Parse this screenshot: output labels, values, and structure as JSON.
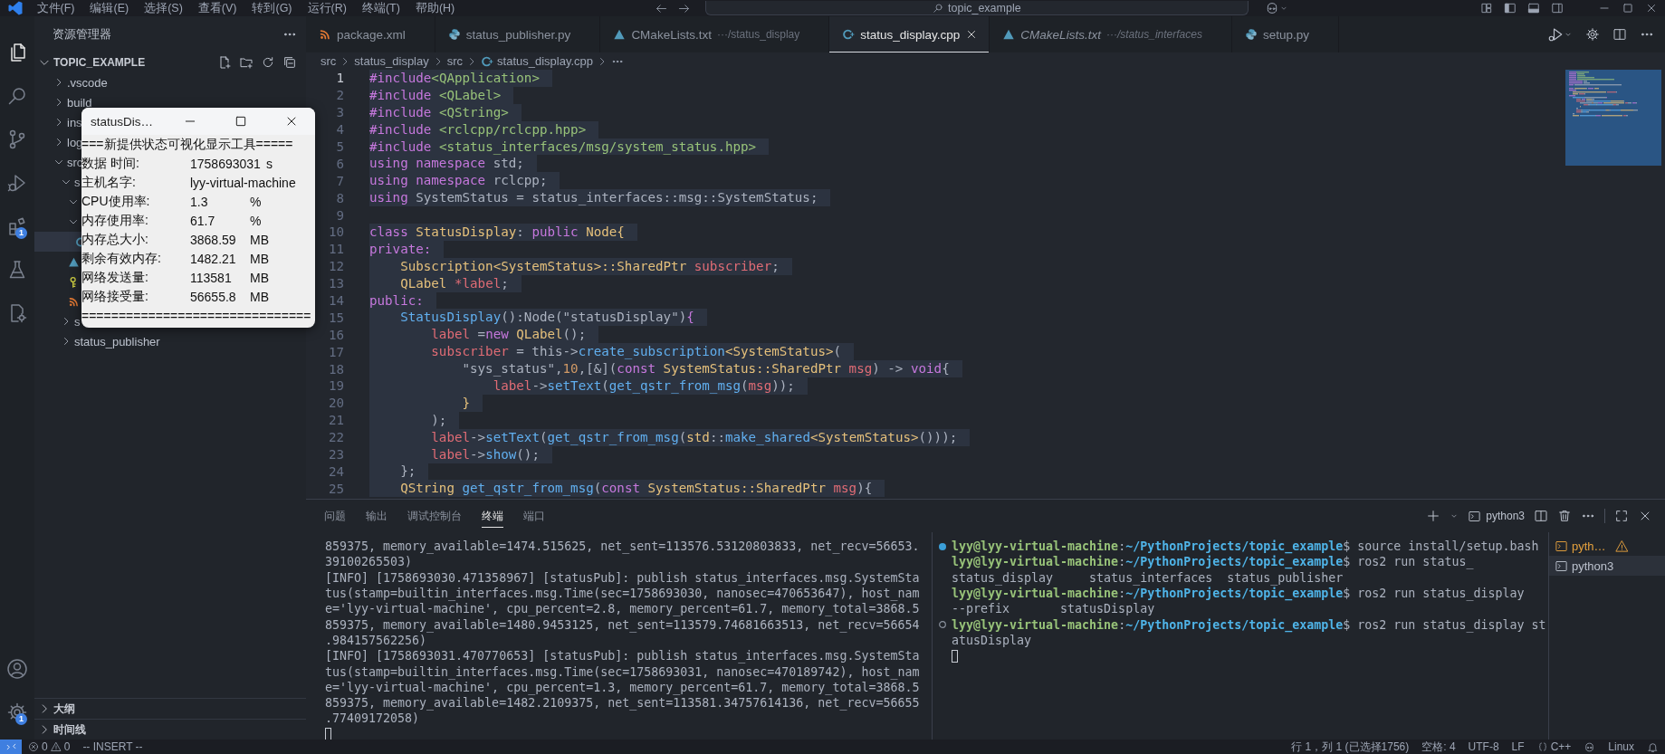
{
  "title_bar": {
    "menus": [
      "文件(F)",
      "编辑(E)",
      "选择(S)",
      "查看(V)",
      "转到(G)",
      "运行(R)",
      "终端(T)",
      "帮助(H)"
    ],
    "search": {
      "value": "topic_example"
    }
  },
  "activity_bar": {
    "items": [
      {
        "kind": "files",
        "selected": true
      },
      {
        "kind": "search",
        "selected": false
      },
      {
        "kind": "source-control",
        "selected": false
      },
      {
        "kind": "run-debug",
        "selected": false
      },
      {
        "kind": "extensions",
        "selected": false,
        "badge": "1"
      },
      {
        "kind": "testing",
        "selected": false
      },
      {
        "kind": "remote",
        "selected": false
      }
    ],
    "bottom": [
      {
        "kind": "account",
        "selected": false
      },
      {
        "kind": "settings",
        "selected": false,
        "badge": "1"
      }
    ]
  },
  "sidebar": {
    "title": "资源管理器",
    "sections": [
      {
        "title": "TOPIC_EXAMPLE",
        "expanded": true,
        "tree": [
          {
            "label": ".vscode",
            "kind": "folder",
            "expanded": false,
            "selected": false
          },
          {
            "label": "build",
            "kind": "folder",
            "expanded": false,
            "selected": false
          },
          {
            "label": "ins",
            "kind": "folder",
            "expanded": false,
            "selected": false
          },
          {
            "label": "log",
            "kind": "folder",
            "expanded": false,
            "selected": false
          },
          {
            "label": "src",
            "kind": "folder",
            "expanded": true,
            "selected": false,
            "children": [
              {
                "label": "s",
                "kind": "folder",
                "expanded": true,
                "selected": false,
                "children": [
                  {
                    "kind": "folder",
                    "expanded": true,
                    "selected": false
                  },
                  {
                    "kind": "folder",
                    "expanded": true,
                    "selected": false,
                    "children": [
                      {
                        "kind": "cpp",
                        "selected": true
                      }
                    ]
                  },
                  {
                    "kind": "cmake",
                    "selected": false
                  },
                  {
                    "kind": "key",
                    "selected": false
                  },
                  {
                    "kind": "rss",
                    "selected": false
                  }
                ]
              },
              {
                "label": "s",
                "kind": "folder",
                "expanded": false,
                "selected": false
              },
              {
                "label": "status_publisher",
                "kind": "folder",
                "expanded": false,
                "selected": false
              }
            ]
          }
        ]
      },
      {
        "title": "大纲",
        "expanded": false
      },
      {
        "title": "时间线",
        "expanded": false
      }
    ]
  },
  "editor": {
    "tabs": [
      {
        "label": "package.xml",
        "kind": "rss",
        "selected": false,
        "preview": false
      },
      {
        "label": "status_publisher.py",
        "kind": "python",
        "selected": false,
        "preview": false
      },
      {
        "label": "CMakeLists.txt",
        "description": "···/status_display",
        "kind": "cmake",
        "selected": false,
        "preview": false
      },
      {
        "label": "status_display.cpp",
        "kind": "cpp",
        "selected": true,
        "preview": false
      },
      {
        "label": "CMakeLists.txt",
        "description": "···/status_interfaces",
        "kind": "cmake",
        "selected": false,
        "preview": true
      },
      {
        "label": "setup.py",
        "kind": "python",
        "selected": false,
        "preview": false
      }
    ],
    "breadcrumb": [
      {
        "label": "src",
        "kind": "folder"
      },
      {
        "label": "status_display",
        "kind": "folder"
      },
      {
        "label": "src",
        "kind": "folder"
      },
      {
        "label": "status_display.cpp",
        "kind": "cpp"
      }
    ],
    "lines": [
      {
        "number": "1",
        "current": true,
        "tokens": [
          {
            "kind": "kw",
            "text": "#include"
          },
          {
            "kind": "str",
            "text": "<QApplication>"
          }
        ]
      },
      {
        "number": "2",
        "current": false,
        "tokens": [
          {
            "kind": "kw",
            "text": "#include"
          },
          {
            "kind": "str",
            "text": " <QLabel>"
          }
        ]
      },
      {
        "number": "3",
        "current": false,
        "tokens": [
          {
            "kind": "kw",
            "text": "#include"
          },
          {
            "kind": "str",
            "text": " <QString>"
          }
        ]
      },
      {
        "number": "4",
        "current": false,
        "tokens": [
          {
            "kind": "kw",
            "text": "#include"
          },
          {
            "kind": "str",
            "text": " <rclcpp/rclcpp.hpp>"
          }
        ]
      },
      {
        "number": "5",
        "current": false,
        "tokens": [
          {
            "kind": "kw",
            "text": "#include"
          },
          {
            "kind": "str",
            "text": " <status_interfaces/msg/system_status.hpp>"
          }
        ]
      },
      {
        "number": "6",
        "current": false,
        "tokens": [
          {
            "kind": "kw",
            "text": "using namespace"
          },
          {
            "kind": "plain",
            "text": " std;"
          }
        ]
      },
      {
        "number": "7",
        "current": false,
        "tokens": [
          {
            "kind": "kw",
            "text": "using namespace"
          },
          {
            "kind": "plain",
            "text": " rclcpp;"
          }
        ]
      },
      {
        "number": "8",
        "current": false,
        "tokens": [
          {
            "kind": "kw",
            "text": "using"
          },
          {
            "kind": "plain",
            "text": " SystemStatus = status_interfaces::msg::SystemStatus;"
          }
        ]
      },
      {
        "number": "9",
        "current": false
      },
      {
        "number": "10",
        "current": false,
        "tokens": [
          {
            "kind": "kw",
            "text": "class"
          },
          {
            "kind": "type",
            "text": " StatusDisplay"
          },
          {
            "kind": "plain",
            "text": ":"
          },
          {
            "kind": "kw",
            "text": " public"
          },
          {
            "kind": "type",
            "text": " Node{"
          }
        ]
      },
      {
        "number": "11",
        "current": false,
        "tokens": [
          {
            "kind": "kw",
            "text": "private:"
          }
        ]
      },
      {
        "number": "12",
        "current": false,
        "tokens": [
          {
            "kind": "type",
            "text": "    Subscription<SystemStatus>::SharedPtr"
          },
          {
            "kind": "var",
            "text": " subscriber"
          },
          {
            "kind": "plain",
            "text": ";"
          }
        ]
      },
      {
        "number": "13",
        "current": false,
        "tokens": [
          {
            "kind": "type",
            "text": "    QLabel"
          },
          {
            "kind": "var",
            "text": " *label"
          },
          {
            "kind": "plain",
            "text": ";"
          }
        ]
      },
      {
        "number": "14",
        "current": false,
        "tokens": [
          {
            "kind": "kw",
            "text": "public:"
          }
        ]
      },
      {
        "number": "15",
        "current": false,
        "tokens": [
          {
            "kind": "fn",
            "text": "    StatusDisplay"
          },
          {
            "kind": "plain",
            "text": "():Node(\"statusDisplay\")"
          },
          {
            "kind": "kw",
            "text": "{"
          }
        ]
      },
      {
        "number": "16",
        "current": false,
        "tokens": [
          {
            "kind": "var",
            "text": "        label"
          },
          {
            "kind": "plain",
            "text": " ="
          },
          {
            "kind": "kw",
            "text": "new"
          },
          {
            "kind": "type",
            "text": " QLabel"
          },
          {
            "kind": "plain",
            "text": "();"
          }
        ]
      },
      {
        "number": "17",
        "current": false,
        "tokens": [
          {
            "kind": "var",
            "text": "        subscriber"
          },
          {
            "kind": "plain",
            "text": " = this->"
          },
          {
            "kind": "fn",
            "text": "create_subscription"
          },
          {
            "kind": "type",
            "text": "<SystemStatus>"
          },
          {
            "kind": "plain",
            "text": "("
          }
        ]
      },
      {
        "number": "18",
        "current": false,
        "tokens": [
          {
            "kind": "plain",
            "text": "            \"sys_status\","
          },
          {
            "kind": "num",
            "text": "10"
          },
          {
            "kind": "plain",
            "text": ",[&]("
          },
          {
            "kind": "kw",
            "text": "const"
          },
          {
            "kind": "type",
            "text": " SystemStatus::SharedPtr"
          },
          {
            "kind": "var",
            "text": " msg"
          },
          {
            "kind": "plain",
            "text": ") -> "
          },
          {
            "kind": "kw",
            "text": "void"
          },
          {
            "kind": "plain",
            "text": "{"
          }
        ]
      },
      {
        "number": "19",
        "current": false,
        "tokens": [
          {
            "kind": "var",
            "text": "                label"
          },
          {
            "kind": "plain",
            "text": "->"
          },
          {
            "kind": "fn",
            "text": "setText"
          },
          {
            "kind": "plain",
            "text": "("
          },
          {
            "kind": "fn",
            "text": "get_qstr_from_msg"
          },
          {
            "kind": "plain",
            "text": "("
          },
          {
            "kind": "var",
            "text": "msg"
          },
          {
            "kind": "plain",
            "text": "));"
          }
        ]
      },
      {
        "number": "20",
        "current": false,
        "tokens": [
          {
            "kind": "type",
            "text": "            }"
          }
        ]
      },
      {
        "number": "21",
        "current": false,
        "tokens": [
          {
            "kind": "plain",
            "text": "        );"
          }
        ]
      },
      {
        "number": "22",
        "current": false,
        "tokens": [
          {
            "kind": "var",
            "text": "        label"
          },
          {
            "kind": "plain",
            "text": "->"
          },
          {
            "kind": "fn",
            "text": "setText"
          },
          {
            "kind": "plain",
            "text": "("
          },
          {
            "kind": "fn",
            "text": "get_qstr_from_msg"
          },
          {
            "kind": "plain",
            "text": "("
          },
          {
            "kind": "type",
            "text": "std"
          },
          {
            "kind": "plain",
            "text": "::"
          },
          {
            "kind": "fn",
            "text": "make_shared"
          },
          {
            "kind": "type",
            "text": "<SystemStatus>"
          },
          {
            "kind": "plain",
            "text": "()));"
          }
        ]
      },
      {
        "number": "23",
        "current": false,
        "tokens": [
          {
            "kind": "var",
            "text": "        label"
          },
          {
            "kind": "plain",
            "text": "->"
          },
          {
            "kind": "fn",
            "text": "show"
          },
          {
            "kind": "plain",
            "text": "();"
          }
        ]
      },
      {
        "number": "24",
        "current": false,
        "tokens": [
          {
            "kind": "plain",
            "text": "    };"
          }
        ]
      },
      {
        "number": "25",
        "current": false,
        "tokens": [
          {
            "kind": "type",
            "text": "    QString"
          },
          {
            "kind": "fn",
            "text": " get_qstr_from_msg"
          },
          {
            "kind": "plain",
            "text": "("
          },
          {
            "kind": "kw",
            "text": "const"
          },
          {
            "kind": "type",
            "text": " SystemStatus::SharedPtr"
          },
          {
            "kind": "var",
            "text": " msg"
          },
          {
            "kind": "plain",
            "text": "){"
          }
        ]
      }
    ]
  },
  "status_window": {
    "title": "statusDis…",
    "header": "===新提供状态可视化显示工具=====",
    "rows": [
      {
        "label": "数据 时间:",
        "value": "1758693031",
        "unit": "s"
      },
      {
        "label": "主机名字:",
        "value": "lyy-virtual-machine"
      },
      {
        "label": "CPU使用率:",
        "value": "1.3",
        "unit": "%"
      },
      {
        "label": "内存使用率:",
        "value": "61.7",
        "unit": "%"
      },
      {
        "label": "内存总大小:",
        "value": "3868.59",
        "unit": "MB"
      },
      {
        "label": "剩余有效内存:",
        "value": "1482.21",
        "unit": "MB"
      },
      {
        "label": "网络发送量:",
        "value": "113581",
        "unit": "MB"
      },
      {
        "label": "网络接受量:",
        "value": "56655.8",
        "unit": "MB"
      }
    ],
    "footer": "==============================="
  },
  "panel": {
    "tabs": [
      {
        "label": "问题",
        "selected": false
      },
      {
        "label": "输出",
        "selected": false
      },
      {
        "label": "调试控制台",
        "selected": false
      },
      {
        "label": "终端",
        "selected": true
      },
      {
        "label": "端口",
        "selected": false
      }
    ],
    "launch_profile": "python3",
    "output": {
      "cursor": true,
      "lines": [
        "859375, memory_available=1474.515625, net_sent=113576.53120803833, net_recv=56653.",
        "39100265503)",
        "[INFO] [1758693030.471358967] [statusPub]: publish status_interfaces.msg.SystemSta",
        "tus(stamp=builtin_interfaces.msg.Time(sec=1758693030, nanosec=470653647), host_nam",
        "e='lyy-virtual-machine', cpu_percent=2.8, memory_percent=61.7, memory_total=3868.5",
        "859375, memory_available=1480.9453125, net_sent=113579.74681663513, net_recv=56654",
        ".984157562256)",
        "[INFO] [1758693031.470770653] [statusPub]: publish status_interfaces.msg.SystemSta",
        "tus(stamp=builtin_interfaces.msg.Time(sec=1758693031, nanosec=470189742), host_nam",
        "e='lyy-virtual-machine', cpu_percent=1.3, memory_percent=61.7, memory_total=3868.5",
        "859375, memory_available=1482.2109375, net_sent=113581.34757614136, net_recv=56655",
        ".77409172058)"
      ]
    },
    "terminal": {
      "lines": [
        {
          "kind": "prompt",
          "succeeded": true,
          "user": "lyy@lyy-virtual-machine",
          "separator": ":",
          "path": "~/PythonProjects/topic_example",
          "command": "$ source install/setup.bash"
        },
        {
          "kind": "prompt",
          "user": "lyy@lyy-virtual-machine",
          "separator": ":",
          "path": "~/PythonProjects/topic_example",
          "command": "$ ros2 run status_"
        },
        {
          "kind": "output",
          "text": "status_display     status_interfaces  status_publisher"
        },
        {
          "kind": "prompt",
          "user": "lyy@lyy-virtual-machine",
          "separator": ":",
          "path": "~/PythonProjects/topic_example",
          "command": "$ ros2 run status_display"
        },
        {
          "kind": "output",
          "text": "--prefix       statusDisplay"
        },
        {
          "kind": "prompt",
          "succeeded": false,
          "user": "lyy@lyy-virtual-machine",
          "separator": ":",
          "path": "~/PythonProjects/topic_example",
          "command": "$ ros2 run status_display st"
        },
        {
          "kind": "output",
          "text": "atusDisplay"
        },
        {
          "kind": "cursor"
        }
      ]
    },
    "terminals": [
      {
        "label": "pyth…",
        "selected": false,
        "warning": true
      },
      {
        "label": "python3",
        "selected": true,
        "warning": false
      }
    ]
  },
  "status_bar": {
    "errors": "0",
    "warnings": "0",
    "mode": "-- INSERT --",
    "position": "行 1，列 1 (已选择1756)",
    "indent": "空格: 4",
    "encoding": "UTF-8",
    "eol": "LF",
    "language": "C++",
    "os": "Linux"
  }
}
